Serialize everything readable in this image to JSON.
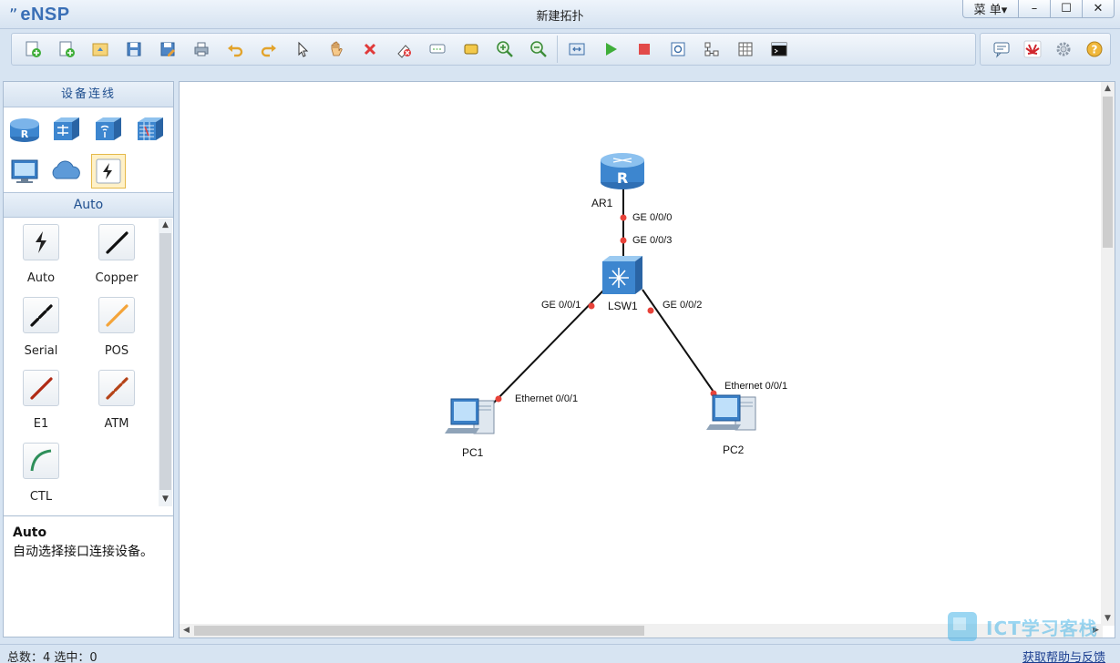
{
  "app": {
    "logo": "eNSP",
    "title": "新建拓扑",
    "menu_label": "菜 单▾"
  },
  "window_buttons": {
    "minimize": "–",
    "maximize": "☐",
    "close": "✕"
  },
  "toolbar": {
    "items": [
      "new-topology",
      "new-lab",
      "open",
      "save",
      "save-as",
      "print",
      "undo",
      "redo",
      "select",
      "pan",
      "delete",
      "delete-link",
      "text-note",
      "palette",
      "zoom-in",
      "zoom-reset",
      "fit",
      "start-all",
      "stop-all",
      "capture",
      "topology-tool",
      "grid",
      "console"
    ],
    "right_items": [
      "chat",
      "huawei-logo",
      "settings",
      "help"
    ]
  },
  "left_panel": {
    "header": "设备连线",
    "devices": [
      "router",
      "switch",
      "wlan",
      "firewall",
      "pc",
      "cloud",
      "connection"
    ],
    "section_title": "Auto",
    "cables": [
      {
        "label": "Auto",
        "color": "#222222"
      },
      {
        "label": "Copper",
        "color": "#111111"
      },
      {
        "label": "Serial",
        "color": "#111111"
      },
      {
        "label": "POS",
        "color": "#f4a43a"
      },
      {
        "label": "E1",
        "color": "#b02a14"
      },
      {
        "label": "ATM",
        "color": "#b54318"
      },
      {
        "label": "CTL",
        "color": "#2e8f5a"
      }
    ],
    "description": {
      "title": "Auto",
      "text": "自动选择接口连接设备。"
    }
  },
  "topology": {
    "nodes": {
      "ar1": "AR1",
      "lsw1": "LSW1",
      "pc1": "PC1",
      "pc2": "PC2"
    },
    "ports": {
      "ar1_lsw1_a": "GE 0/0/0",
      "ar1_lsw1_b": "GE 0/0/3",
      "lsw1_pc1_a": "GE 0/0/1",
      "lsw1_pc1_b": "Ethernet 0/0/1",
      "lsw1_pc2_a": "GE 0/0/2",
      "lsw1_pc2_b": "Ethernet 0/0/1"
    }
  },
  "watermark": "ICT学习客栈",
  "status": {
    "summary": "总数：4  选中：0",
    "help_link": "获取帮助与反馈"
  }
}
